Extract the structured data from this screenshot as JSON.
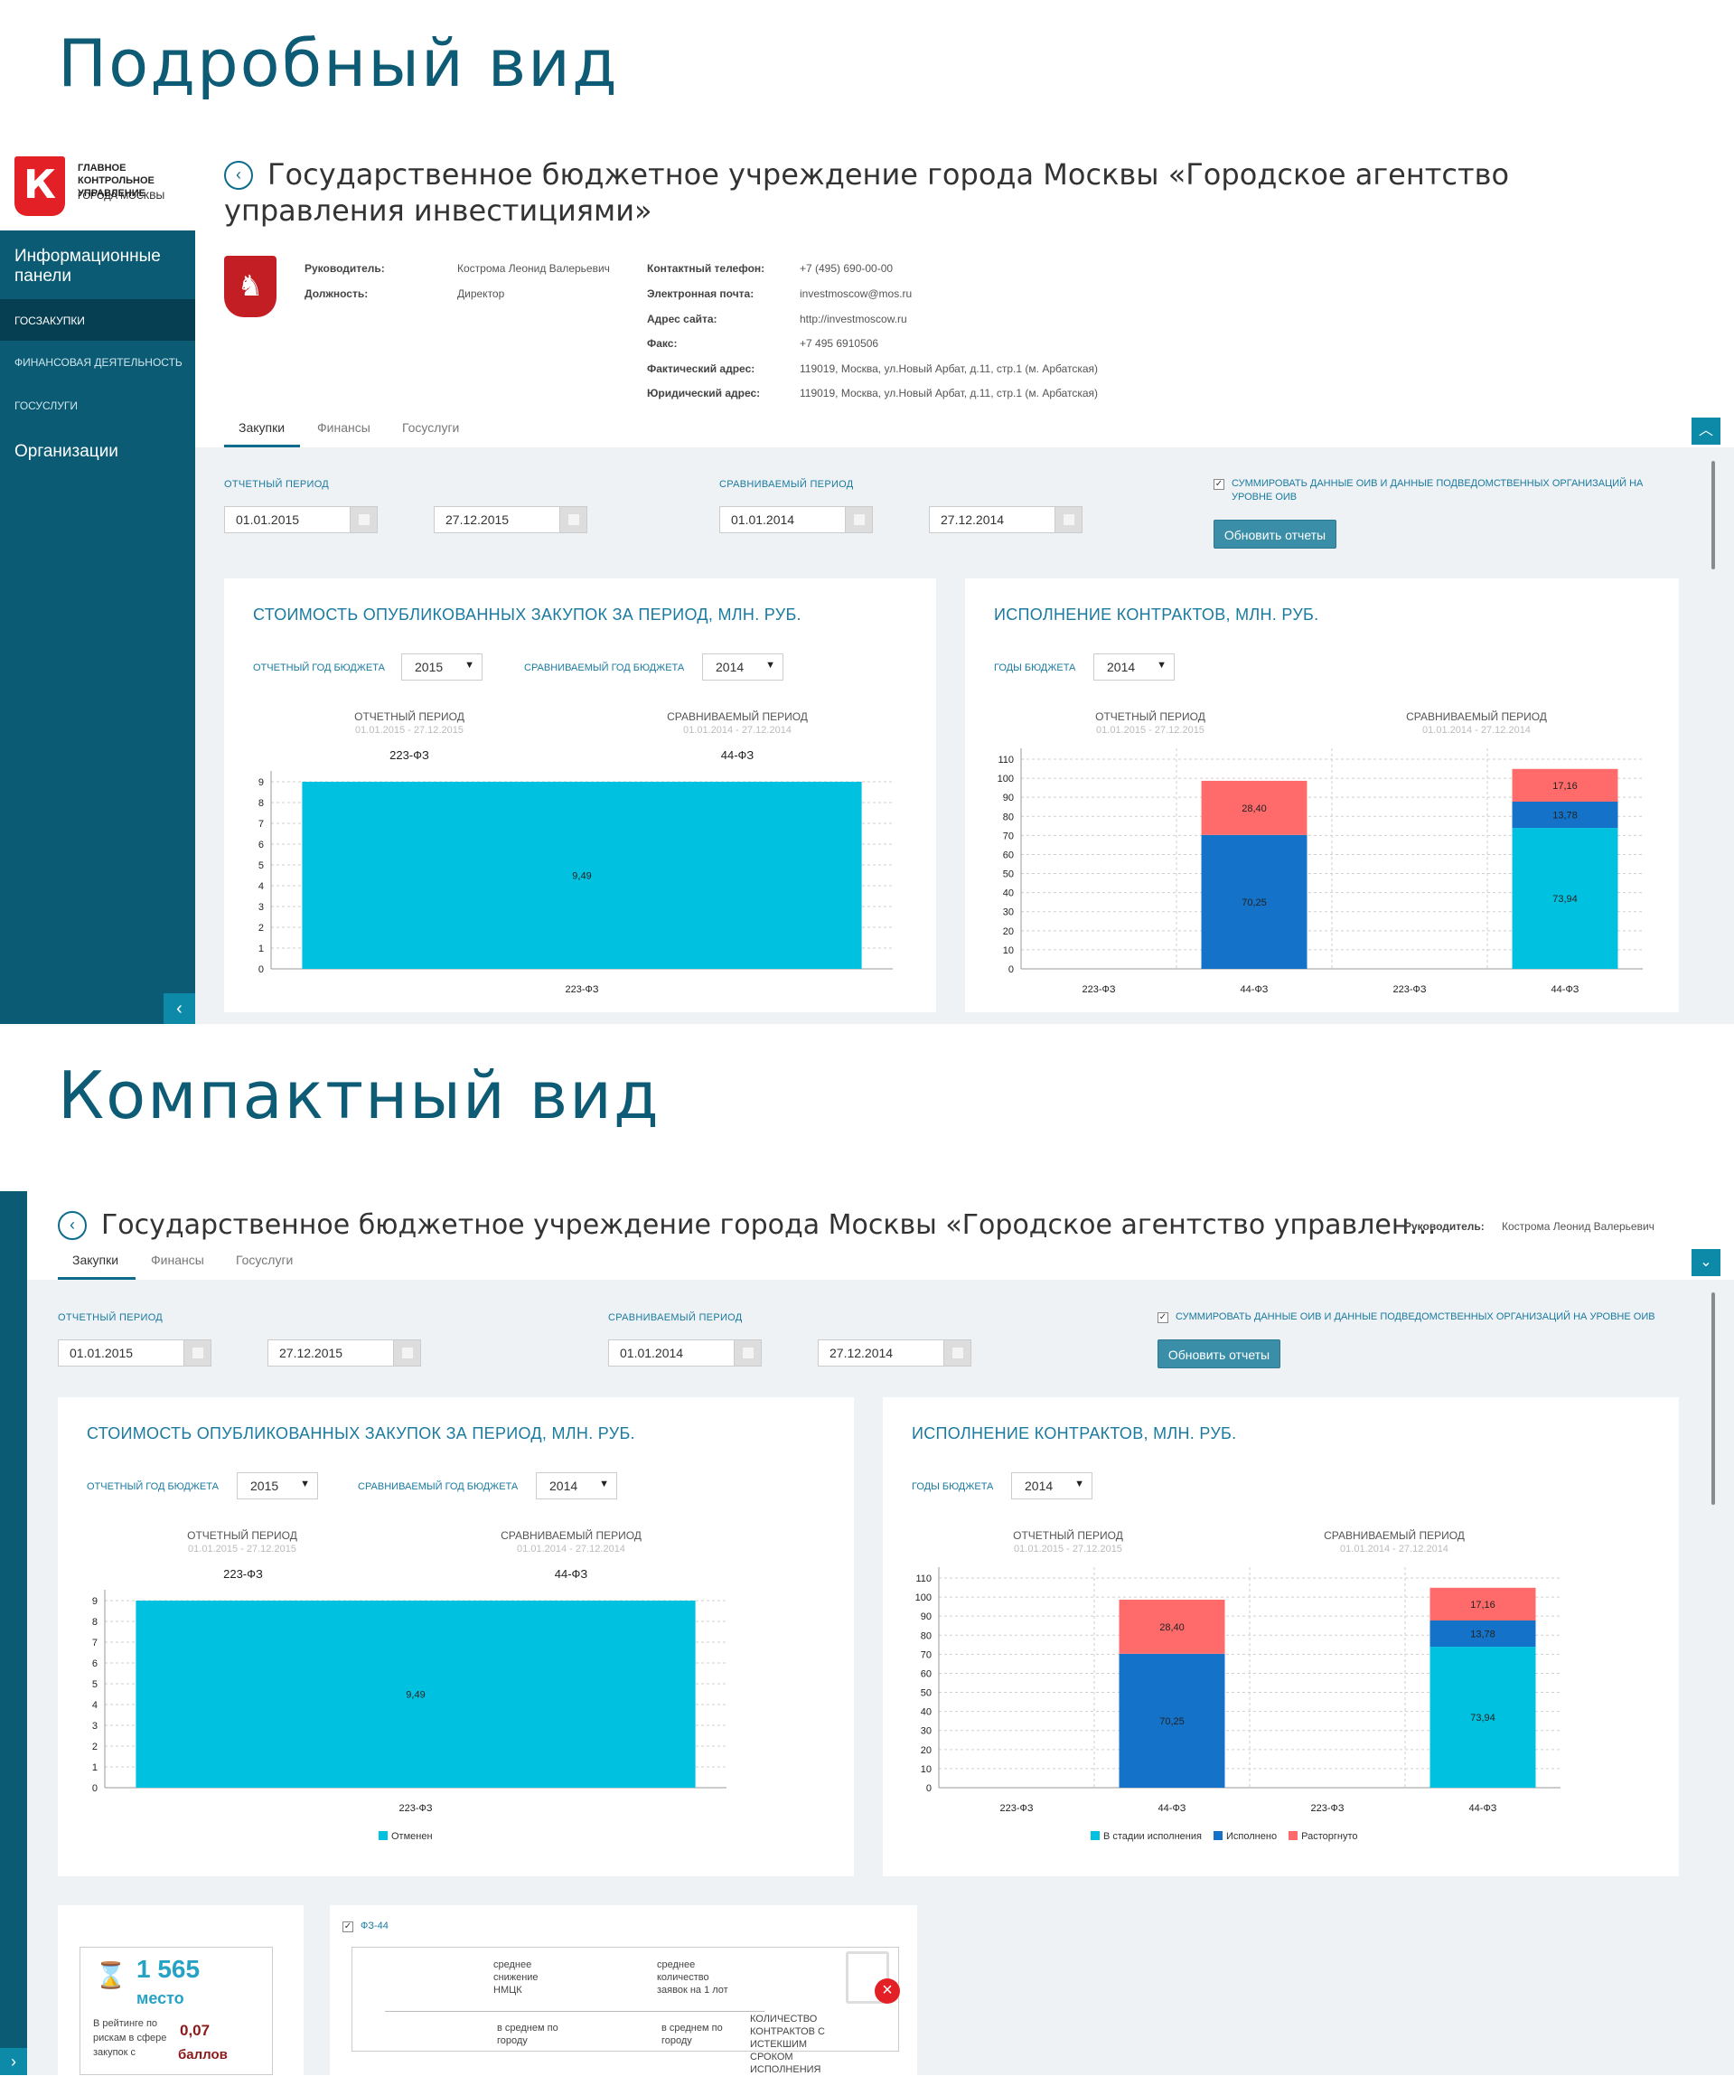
{
  "headings": {
    "detailed": "Подробный вид",
    "compact": "Компактный вид"
  },
  "logo": {
    "mark": "К",
    "line1": "ГЛАВНОЕ КОНТРОЛЬНОЕ УПРАВЛЕНИЕ",
    "line2": "ГОРОДА МОСКВЫ"
  },
  "sidebar": {
    "info_panels": "Информационные панели",
    "items": [
      "ГОСЗАКУПКИ",
      "ФИНАНСОВАЯ ДЕЯТЕЛЬНОСТЬ",
      "ГОСУСЛУГИ"
    ],
    "organizations": "Организации",
    "collapse_glyph": "‹"
  },
  "org": {
    "title_full": "Государственное бюджетное учреждение города Москвы «Городское агентство управления инвестициями»",
    "title_short": "Государственное бюджетное учреждение города Москвы «Городское агентство управлен…",
    "emblem_glyph": "♞",
    "fields_left": [
      {
        "label": "Руководитель:",
        "value": "Кострома Леонид Валерьевич"
      },
      {
        "label": "Должность:",
        "value": "Директор"
      }
    ],
    "fields_right": [
      {
        "label": "Контактный телефон:",
        "value": "+7 (495) 690-00-00"
      },
      {
        "label": "Электронная почта:",
        "value": "investmoscow@mos.ru"
      },
      {
        "label": "Адрес сайта:",
        "value": "http://investmoscow.ru"
      },
      {
        "label": "Факс:",
        "value": "+7 495 6910506"
      },
      {
        "label": "Фактический адрес:",
        "value": "119019, Москва, ул.Новый Арбат, д.11, стр.1 (м. Арбатская)"
      },
      {
        "label": "Юридический адрес:",
        "value": "119019, Москва, ул.Новый Арбат, д.11, стр.1 (м. Арбатская)"
      }
    ]
  },
  "tabs": [
    "Закупки",
    "Финансы",
    "Госуслуги"
  ],
  "filters": {
    "report_period_label": "ОТЧЕТНЫЙ ПЕРИОД",
    "compare_period_label": "СРАВНИВАЕМЫЙ ПЕРИОД",
    "report_from": "01.01.2015",
    "report_to": "27.12.2015",
    "compare_from": "01.01.2014",
    "compare_to": "27.12.2014",
    "sum_checkbox_label": "СУММИРОВАТЬ ДАННЫЕ ОИВ И ДАННЫЕ ПОДВЕДОМСТВЕННЫХ ОРГАНИЗАЦИЙ НА УРОВНЕ ОИВ",
    "sum_checked": true,
    "update_button": "Обновить отчеты"
  },
  "panel_procurement": {
    "title": "СТОИМОСТЬ ОПУБЛИКОВАННЫХ ЗАКУПОК ЗА ПЕРИОД, МЛН. РУБ.",
    "report_year_label": "ОТЧЕТНЫЙ ГОД БЮДЖЕТА",
    "report_year": "2015",
    "compare_year_label": "СРАВНИВАЕМЫЙ ГОД БЮДЖЕТА",
    "compare_year": "2014",
    "period_report": "ОТЧЕТНЫЙ ПЕРИОД",
    "period_report_dates": "01.01.2015 - 27.12.2015",
    "period_compare": "СРАВНИВАЕМЫЙ ПЕРИОД",
    "period_compare_dates": "01.01.2014 - 27.12.2014",
    "law_report": "223-ФЗ",
    "law_compare": "44-ФЗ",
    "legend": [
      {
        "label": "Отменен",
        "color": "#00c2e0"
      }
    ]
  },
  "panel_contracts": {
    "title": "ИСПОЛНЕНИЕ КОНТРАКТОВ, МЛН. РУБ.",
    "year_label": "ГОДЫ БЮДЖЕТА",
    "year": "2014",
    "period_report": "ОТЧЕТНЫЙ ПЕРИОД",
    "period_report_dates": "01.01.2015 - 27.12.2015",
    "period_compare": "СРАВНИВАЕМЫЙ ПЕРИОД",
    "period_compare_dates": "01.01.2014 - 27.12.2014",
    "legend": [
      {
        "label": "В стадии исполнения",
        "color": "#00c2e0"
      },
      {
        "label": "Исполнено",
        "color": "#1473c8"
      },
      {
        "label": "Расторгнуто",
        "color": "#ff6b6b"
      }
    ]
  },
  "chart_data": [
    {
      "type": "bar",
      "title": "СТОИМОСТЬ ОПУБЛИКОВАННЫХ ЗАКУПОК ЗА ПЕРИОД, МЛН. РУБ.",
      "categories": [
        "223-ФЗ"
      ],
      "series": [
        {
          "name": "Отменен",
          "values": [
            9.49
          ],
          "labels": [
            "9,49"
          ],
          "color": "#00c2e0"
        }
      ],
      "ylim": [
        0,
        9
      ],
      "yticks": [
        0,
        1,
        2,
        3,
        4,
        5,
        6,
        7,
        8,
        9
      ],
      "grid": true
    },
    {
      "type": "bar",
      "stacked": true,
      "title": "ИСПОЛНЕНИЕ КОНТРАКТОВ, МЛН. РУБ.",
      "categories": [
        "223-ФЗ",
        "44-ФЗ",
        "223-ФЗ",
        "44-ФЗ"
      ],
      "series": [
        {
          "name": "В стадии исполнения",
          "color": "#00c2e0",
          "values": [
            0,
            0,
            0,
            73.94
          ],
          "labels": [
            "",
            "",
            "",
            "73,94"
          ]
        },
        {
          "name": "Исполнено",
          "color": "#1473c8",
          "values": [
            0,
            70.25,
            0,
            13.78
          ],
          "labels": [
            "",
            "70,25",
            "",
            "13,78"
          ]
        },
        {
          "name": "Расторгнуто",
          "color": "#ff6b6b",
          "values": [
            0,
            28.4,
            0,
            17.16
          ],
          "labels": [
            "",
            "28,40",
            "",
            "17,16"
          ]
        }
      ],
      "ylim": [
        0,
        110
      ],
      "yticks": [
        0,
        10,
        20,
        30,
        40,
        50,
        60,
        70,
        80,
        90,
        100,
        110
      ],
      "grid": true
    }
  ],
  "compact_header": {
    "manager_label": "Руководитель:",
    "manager_value": "Кострома Леонид Валерьевич",
    "toggle_glyph": "⌄"
  },
  "rating": {
    "place": "1 565",
    "place_word": "место",
    "desc": "В рейтинге по рискам в сфере закупок с",
    "score": "0,07",
    "score_word": "баллов"
  },
  "stats": {
    "checkbox_label": "ФЗ-44",
    "col1_title": "среднее снижение НМЦК",
    "col2_title": "среднее количество заявок на 1 лот",
    "col1_sub": "в среднем по городу",
    "col2_sub": "в среднем по городу",
    "expired": "КОЛИЧЕСТВО КОНТРАКТОВ С ИСТЕКШИМ СРОКОМ ИСПОЛНЕНИЯ"
  },
  "colors": {
    "sidebar": "#0a5b73",
    "accent": "#0e8aa9",
    "cyan": "#00c2e0",
    "blue": "#1473c8",
    "red": "#ff6b6b"
  }
}
